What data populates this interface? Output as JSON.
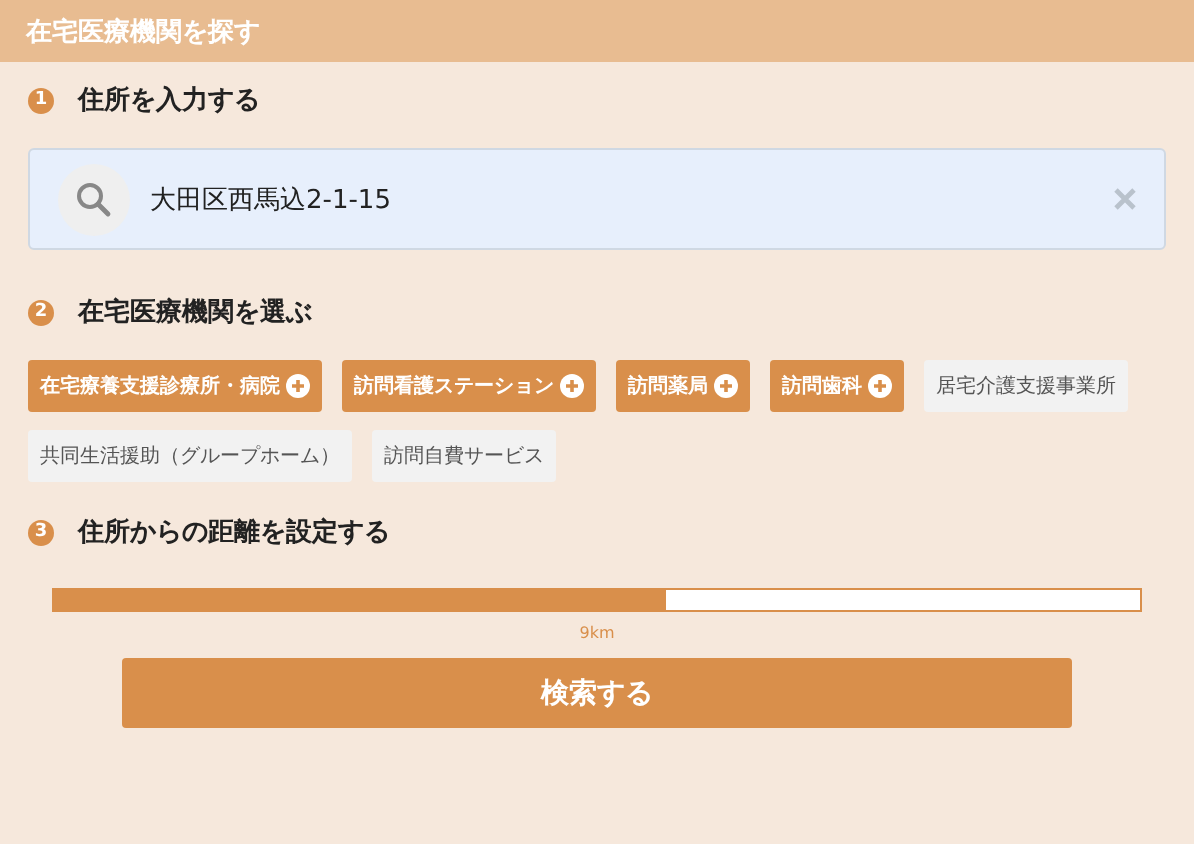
{
  "header": {
    "title": "在宅医療機関を探す"
  },
  "steps": [
    {
      "number": "1",
      "title": "住所を入力する",
      "kind": "address"
    },
    {
      "number": "2",
      "title": "在宅医療機関を選ぶ",
      "kind": "types"
    },
    {
      "number": "3",
      "title": "住所からの距離を設定する",
      "kind": "distance"
    }
  ],
  "address": {
    "value": "大田区西馬込2-1-15"
  },
  "facility_types": [
    {
      "label": "在宅療養支援診療所・病院",
      "selected": true
    },
    {
      "label": "訪問看護ステーション",
      "selected": true
    },
    {
      "label": "訪問薬局",
      "selected": true
    },
    {
      "label": "訪問歯科",
      "selected": true
    },
    {
      "label": "居宅介護支援事業所",
      "selected": false
    },
    {
      "label": "共同生活援助（グループホーム）",
      "selected": false
    },
    {
      "label": "訪問自費サービス",
      "selected": false
    }
  ],
  "distance": {
    "level": 0.563,
    "reading": "9km"
  },
  "search_button": "検索する"
}
